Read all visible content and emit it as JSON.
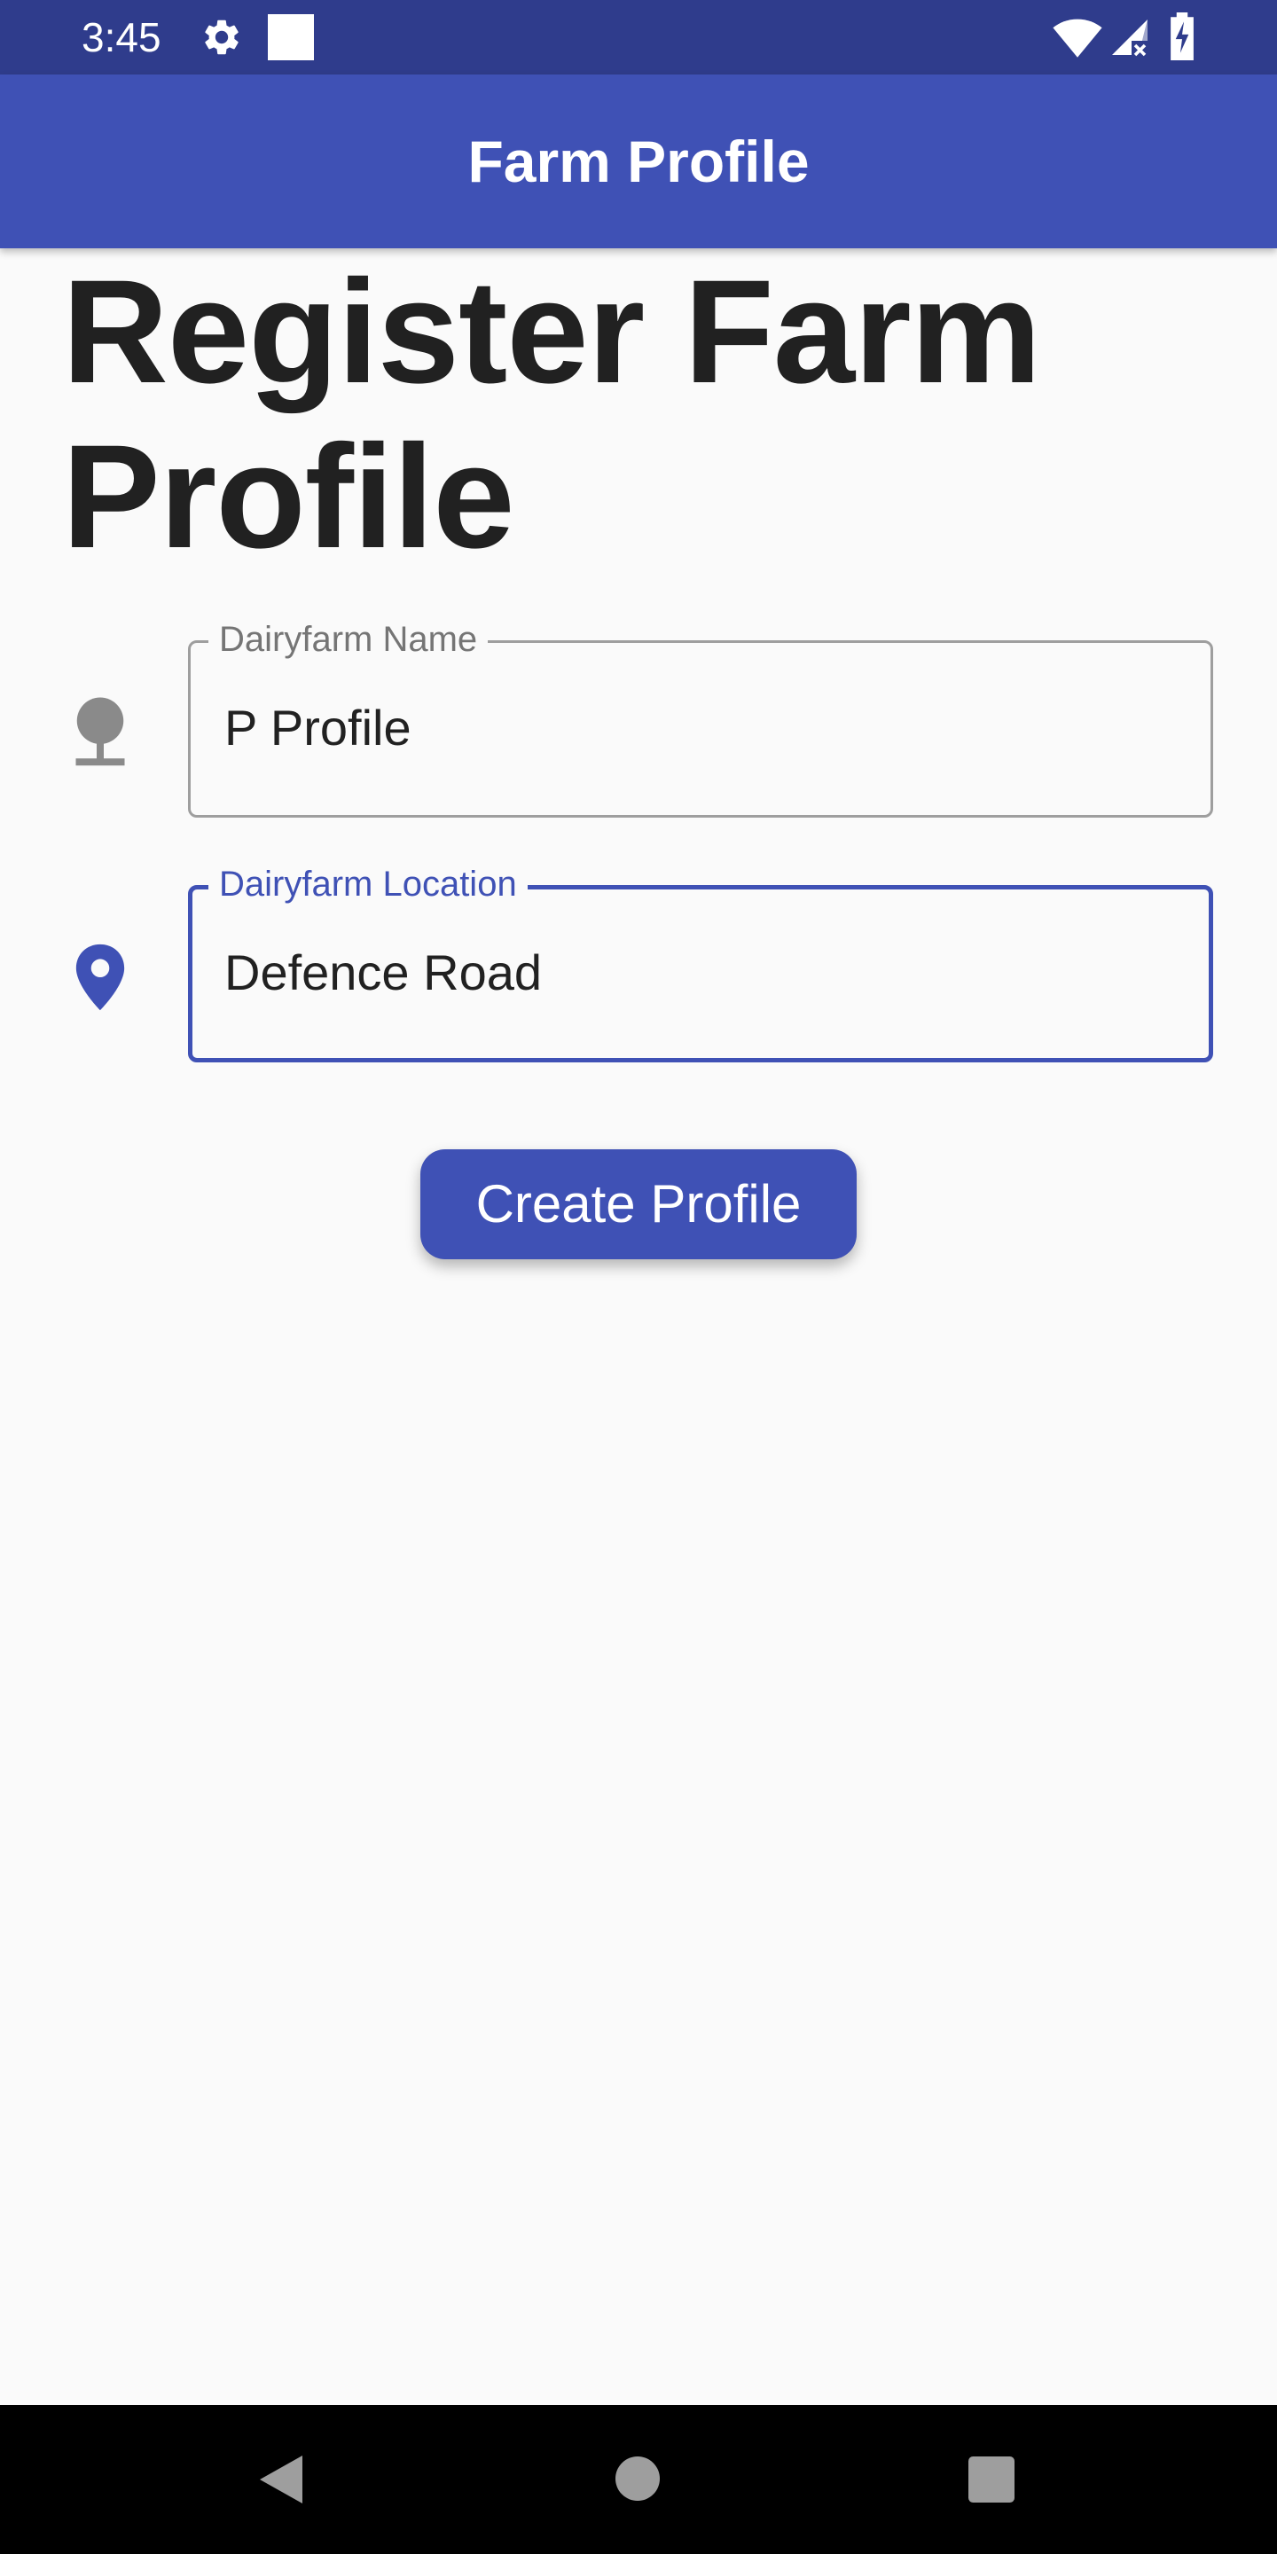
{
  "status_bar": {
    "time": "3:45",
    "icons": [
      "gear-icon",
      "square-notification-icon",
      "wifi-icon",
      "signal-icon",
      "battery-charging-icon"
    ],
    "background": "#2f3c8c"
  },
  "app_bar": {
    "title": "Farm Profile",
    "background": "#3f51b5"
  },
  "page": {
    "heading": "Register Farm Profile"
  },
  "form": {
    "farm_name": {
      "label": "Dairyfarm Name",
      "value": "P Profile",
      "icon": "tree-icon",
      "focused": false
    },
    "farm_location": {
      "label": "Dairyfarm Location",
      "value": "Defence Road",
      "icon": "location-pin-icon",
      "focused": true
    },
    "submit_label": "Create Profile"
  },
  "colors": {
    "primary": "#3f51b5",
    "inactive_outline": "#9e9e9e",
    "background": "#fafafa"
  },
  "nav_bar": {
    "icons": [
      "back-icon",
      "home-icon",
      "recents-icon"
    ]
  }
}
